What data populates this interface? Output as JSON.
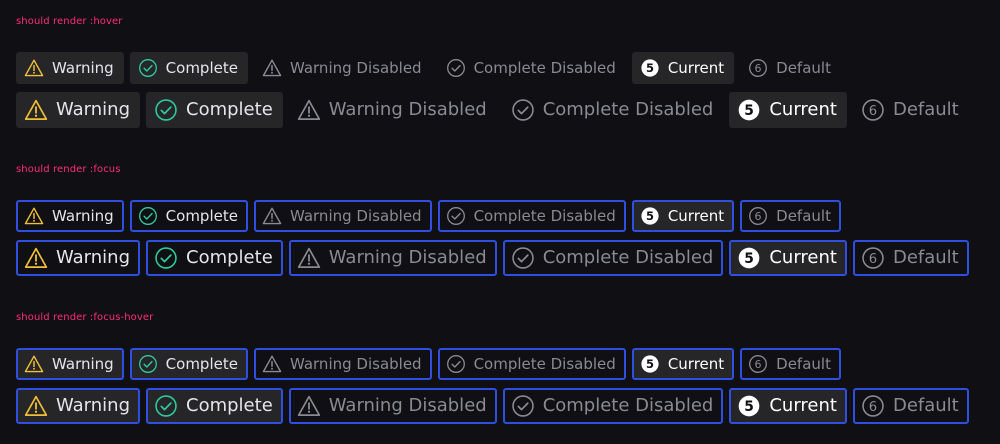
{
  "colors": {
    "background": "#0f0f14",
    "section_title": "#ff2d78",
    "warning": "#f2c037",
    "complete": "#2ecc9a",
    "focus_ring": "#2f4fe0",
    "hover_fill": "#262629",
    "muted": "#8a8a93"
  },
  "sections": [
    {
      "title": "should render :hover",
      "rows": [
        {
          "size": "sm",
          "steps": [
            {
              "label": "Warning",
              "type": "warning",
              "icon": "warning-triangle-icon",
              "hover": true,
              "focus": false
            },
            {
              "label": "Complete",
              "type": "complete",
              "icon": "check-circle-icon",
              "hover": true,
              "focus": false
            },
            {
              "label": "Warning Disabled",
              "type": "warning-disabled",
              "icon": "warning-triangle-icon",
              "hover": false,
              "focus": false
            },
            {
              "label": "Complete Disabled",
              "type": "complete-disabled",
              "icon": "check-circle-icon",
              "hover": false,
              "focus": false
            },
            {
              "label": "Current",
              "type": "current",
              "icon": "number-circle-icon",
              "num": "5",
              "hover": true,
              "focus": false
            },
            {
              "label": "Default",
              "type": "default",
              "icon": "number-circle-outline-icon",
              "num": "6",
              "hover": false,
              "focus": false
            }
          ]
        },
        {
          "size": "lg",
          "steps": [
            {
              "label": "Warning",
              "type": "warning",
              "icon": "warning-triangle-icon",
              "hover": true,
              "focus": false
            },
            {
              "label": "Complete",
              "type": "complete",
              "icon": "check-circle-icon",
              "hover": true,
              "focus": false
            },
            {
              "label": "Warning Disabled",
              "type": "warning-disabled",
              "icon": "warning-triangle-icon",
              "hover": false,
              "focus": false
            },
            {
              "label": "Complete Disabled",
              "type": "complete-disabled",
              "icon": "check-circle-icon",
              "hover": false,
              "focus": false
            },
            {
              "label": "Current",
              "type": "current",
              "icon": "number-circle-icon",
              "num": "5",
              "hover": true,
              "focus": false
            },
            {
              "label": "Default",
              "type": "default",
              "icon": "number-circle-outline-icon",
              "num": "6",
              "hover": false,
              "focus": false
            }
          ]
        }
      ]
    },
    {
      "title": "should render :focus",
      "rows": [
        {
          "size": "sm",
          "steps": [
            {
              "label": "Warning",
              "type": "warning",
              "icon": "warning-triangle-icon",
              "hover": false,
              "focus": true
            },
            {
              "label": "Complete",
              "type": "complete",
              "icon": "check-circle-icon",
              "hover": false,
              "focus": true
            },
            {
              "label": "Warning Disabled",
              "type": "warning-disabled",
              "icon": "warning-triangle-icon",
              "hover": false,
              "focus": true
            },
            {
              "label": "Complete Disabled",
              "type": "complete-disabled",
              "icon": "check-circle-icon",
              "hover": false,
              "focus": true
            },
            {
              "label": "Current",
              "type": "current",
              "icon": "number-circle-icon",
              "num": "5",
              "hover": true,
              "focus": true
            },
            {
              "label": "Default",
              "type": "default",
              "icon": "number-circle-outline-icon",
              "num": "6",
              "hover": false,
              "focus": true
            }
          ]
        },
        {
          "size": "lg",
          "steps": [
            {
              "label": "Warning",
              "type": "warning",
              "icon": "warning-triangle-icon",
              "hover": false,
              "focus": true
            },
            {
              "label": "Complete",
              "type": "complete",
              "icon": "check-circle-icon",
              "hover": false,
              "focus": true
            },
            {
              "label": "Warning Disabled",
              "type": "warning-disabled",
              "icon": "warning-triangle-icon",
              "hover": false,
              "focus": true
            },
            {
              "label": "Complete Disabled",
              "type": "complete-disabled",
              "icon": "check-circle-icon",
              "hover": false,
              "focus": true
            },
            {
              "label": "Current",
              "type": "current",
              "icon": "number-circle-icon",
              "num": "5",
              "hover": true,
              "focus": true
            },
            {
              "label": "Default",
              "type": "default",
              "icon": "number-circle-outline-icon",
              "num": "6",
              "hover": false,
              "focus": true
            }
          ]
        }
      ]
    },
    {
      "title": "should render :focus-hover",
      "rows": [
        {
          "size": "sm",
          "steps": [
            {
              "label": "Warning",
              "type": "warning",
              "icon": "warning-triangle-icon",
              "hover": true,
              "focus": true
            },
            {
              "label": "Complete",
              "type": "complete",
              "icon": "check-circle-icon",
              "hover": true,
              "focus": true
            },
            {
              "label": "Warning Disabled",
              "type": "warning-disabled",
              "icon": "warning-triangle-icon",
              "hover": false,
              "focus": true
            },
            {
              "label": "Complete Disabled",
              "type": "complete-disabled",
              "icon": "check-circle-icon",
              "hover": false,
              "focus": true
            },
            {
              "label": "Current",
              "type": "current",
              "icon": "number-circle-icon",
              "num": "5",
              "hover": true,
              "focus": true
            },
            {
              "label": "Default",
              "type": "default",
              "icon": "number-circle-outline-icon",
              "num": "6",
              "hover": false,
              "focus": true
            }
          ]
        },
        {
          "size": "lg",
          "steps": [
            {
              "label": "Warning",
              "type": "warning",
              "icon": "warning-triangle-icon",
              "hover": true,
              "focus": true
            },
            {
              "label": "Complete",
              "type": "complete",
              "icon": "check-circle-icon",
              "hover": true,
              "focus": true
            },
            {
              "label": "Warning Disabled",
              "type": "warning-disabled",
              "icon": "warning-triangle-icon",
              "hover": false,
              "focus": true
            },
            {
              "label": "Complete Disabled",
              "type": "complete-disabled",
              "icon": "check-circle-icon",
              "hover": false,
              "focus": true
            },
            {
              "label": "Current",
              "type": "current",
              "icon": "number-circle-icon",
              "num": "5",
              "hover": true,
              "focus": true
            },
            {
              "label": "Default",
              "type": "default",
              "icon": "number-circle-outline-icon",
              "num": "6",
              "hover": false,
              "focus": true
            }
          ]
        }
      ]
    }
  ]
}
